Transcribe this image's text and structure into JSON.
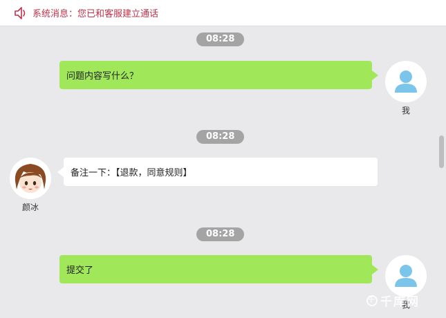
{
  "system_bar": {
    "icon": "speaker-icon",
    "label": "系统消息",
    "separator": "：",
    "message": "您已和客服建立通话"
  },
  "messages": [
    {
      "time": "08:28",
      "sender": "我",
      "side": "right",
      "text": "问题内容写什么？"
    },
    {
      "time": "08:28",
      "sender": "颜冰",
      "side": "left",
      "text": "备注一下：【退款，同意规则】"
    },
    {
      "time": "08:28",
      "sender": "我",
      "side": "right",
      "text": "提交了"
    }
  ],
  "watermark": {
    "text": "千库网"
  },
  "colors": {
    "system_text": "#c0304a",
    "outgoing_bubble": "#a0e75a",
    "incoming_bubble": "#ffffff",
    "timestamp_pill": "#a4a4a4",
    "background": "#e9e9ec",
    "user_avatar": "#7cc5ea"
  }
}
